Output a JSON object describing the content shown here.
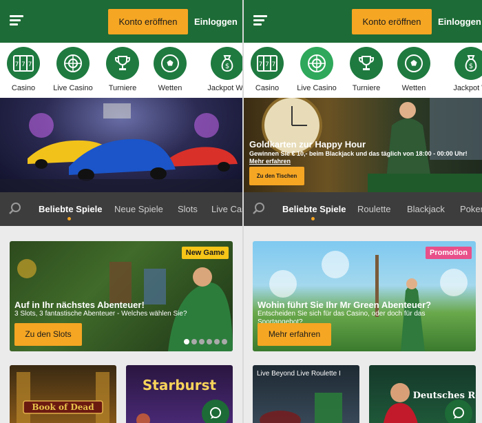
{
  "header": {
    "register_label": "Konto eröffnen",
    "login_label": "Einloggen"
  },
  "categories": [
    {
      "label": "Casino",
      "icon": "slot-machine-icon"
    },
    {
      "label": "Live Casino",
      "icon": "roulette-wheel-icon"
    },
    {
      "label": "Turniere",
      "icon": "trophy-icon"
    },
    {
      "label": "Wetten",
      "icon": "football-icon"
    },
    {
      "label": "Jackpot We",
      "icon": "money-bag-icon"
    },
    {
      "label": "Jackpot W",
      "icon": "money-bag-icon"
    }
  ],
  "left": {
    "tabs": [
      "Beliebte Spiele",
      "Neue Spiele",
      "Slots",
      "Live Cas"
    ],
    "promo": {
      "badge": "New Game",
      "title": "Auf in Ihr nächstes Abenteuer!",
      "subtitle": "3 Slots, 3 fantastische Abenteuer - Welches wählen Sie?",
      "button": "Zu den Slots"
    },
    "tiles": [
      {
        "label": "Book of Dead"
      },
      {
        "label": "Starburst"
      }
    ]
  },
  "right": {
    "hero": {
      "title": "Goldkarten zur Happy Hour",
      "text": "Gewinnen Sie € 10,- beim Blackjack und das täglich von 18:00 - 00:00 Uhr!",
      "link": "Mehr erfahren",
      "button": "Zu den Tischen"
    },
    "tabs": [
      "Beliebte Spiele",
      "Roulette",
      "Blackjack",
      "Poker"
    ],
    "promo": {
      "badge": "Promotion",
      "title": "Wohin führt Sie Ihr Mr Green Abenteuer?",
      "subtitle": "Entscheiden Sie sich für das Casino, oder doch für das Sportangebot?",
      "button": "Mehr erfahren"
    },
    "tiles": [
      {
        "label": "Live Beyond Live Roulette I"
      },
      {
        "label": "Deutsches Rou"
      }
    ]
  },
  "colors": {
    "brand_green": "#1d6b36",
    "accent_orange": "#f5a623",
    "tab_bar": "#3d3d3d",
    "badge_yellow": "#f5c518",
    "badge_pink": "#e8508a"
  }
}
